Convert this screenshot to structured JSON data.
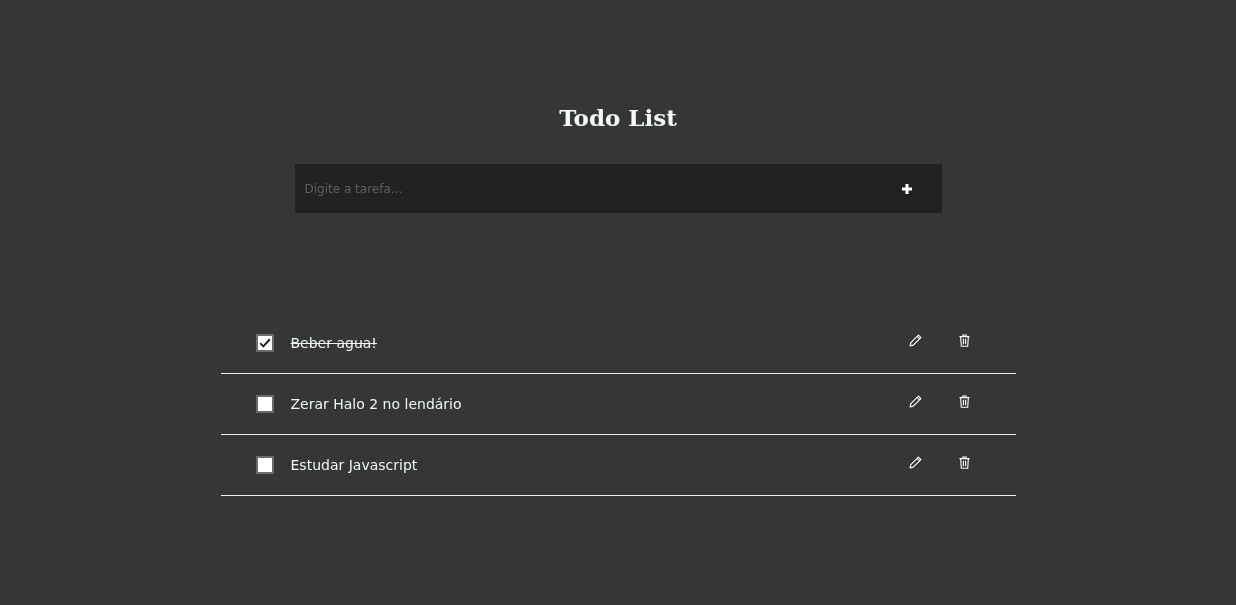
{
  "title": "Todo List",
  "new_task": {
    "placeholder": "Digite a tarefa..."
  },
  "tasks": [
    {
      "text": "Beber agua!",
      "checked": true
    },
    {
      "text": "Zerar Halo 2 no lendário",
      "checked": false
    },
    {
      "text": "Estudar Javascript",
      "checked": false
    }
  ]
}
